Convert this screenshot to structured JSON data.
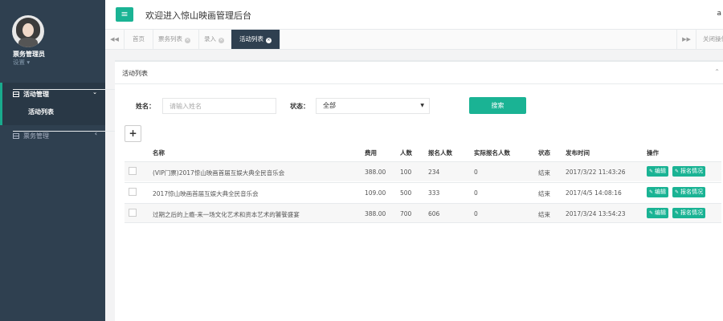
{
  "sidebar": {
    "user_name": "票务管理员",
    "user_settings": "设置",
    "nav": [
      {
        "label": "活动管理",
        "arrow": "⌄",
        "sub": "活动列表"
      },
      {
        "label": "票务管理",
        "arrow": "‹"
      }
    ]
  },
  "header": {
    "menu_icon": "≡",
    "welcome": "欢迎进入惊山映画管理后台",
    "right_fragment": "a"
  },
  "tabs": {
    "items": [
      "首页",
      "票务列表",
      "录入",
      "活动列表"
    ],
    "active_index": 3,
    "close_label": "关闭操作"
  },
  "panel": {
    "title": "活动列表",
    "filters": {
      "name_label": "姓名：",
      "name_placeholder": "请输入姓名",
      "status_label": "状态：",
      "status_value": "全部",
      "search_label": "搜索"
    },
    "add_label": "+",
    "table": {
      "headers": [
        "名称",
        "费用",
        "人数",
        "报名人数",
        "实际报名人数",
        "状态",
        "发布时间",
        "操作"
      ],
      "rows": [
        {
          "name": "(VIP门票)2017惊山映画首届互娱大典全民音乐会",
          "fee": "388.00",
          "people": "100",
          "signed": "234",
          "actual": "0",
          "status": "结束",
          "time": "2017/3/22 11:43:26"
        },
        {
          "name": "2017惊山映画首届互娱大典全民音乐会",
          "fee": "109.00",
          "people": "500",
          "signed": "333",
          "actual": "0",
          "status": "结束",
          "time": "2017/4/5 14:08:16"
        },
        {
          "name": "过期之后的上瘾-来一场文化艺术和资本艺术的饕餮盛宴",
          "fee": "388.00",
          "people": "700",
          "signed": "606",
          "actual": "0",
          "status": "结束",
          "time": "2017/3/24 13:54:23"
        }
      ],
      "edit_label": "编辑",
      "signup_label": "报名情况"
    }
  },
  "colors": {
    "accent": "#1ab394",
    "sidebar": "#2f4050"
  }
}
